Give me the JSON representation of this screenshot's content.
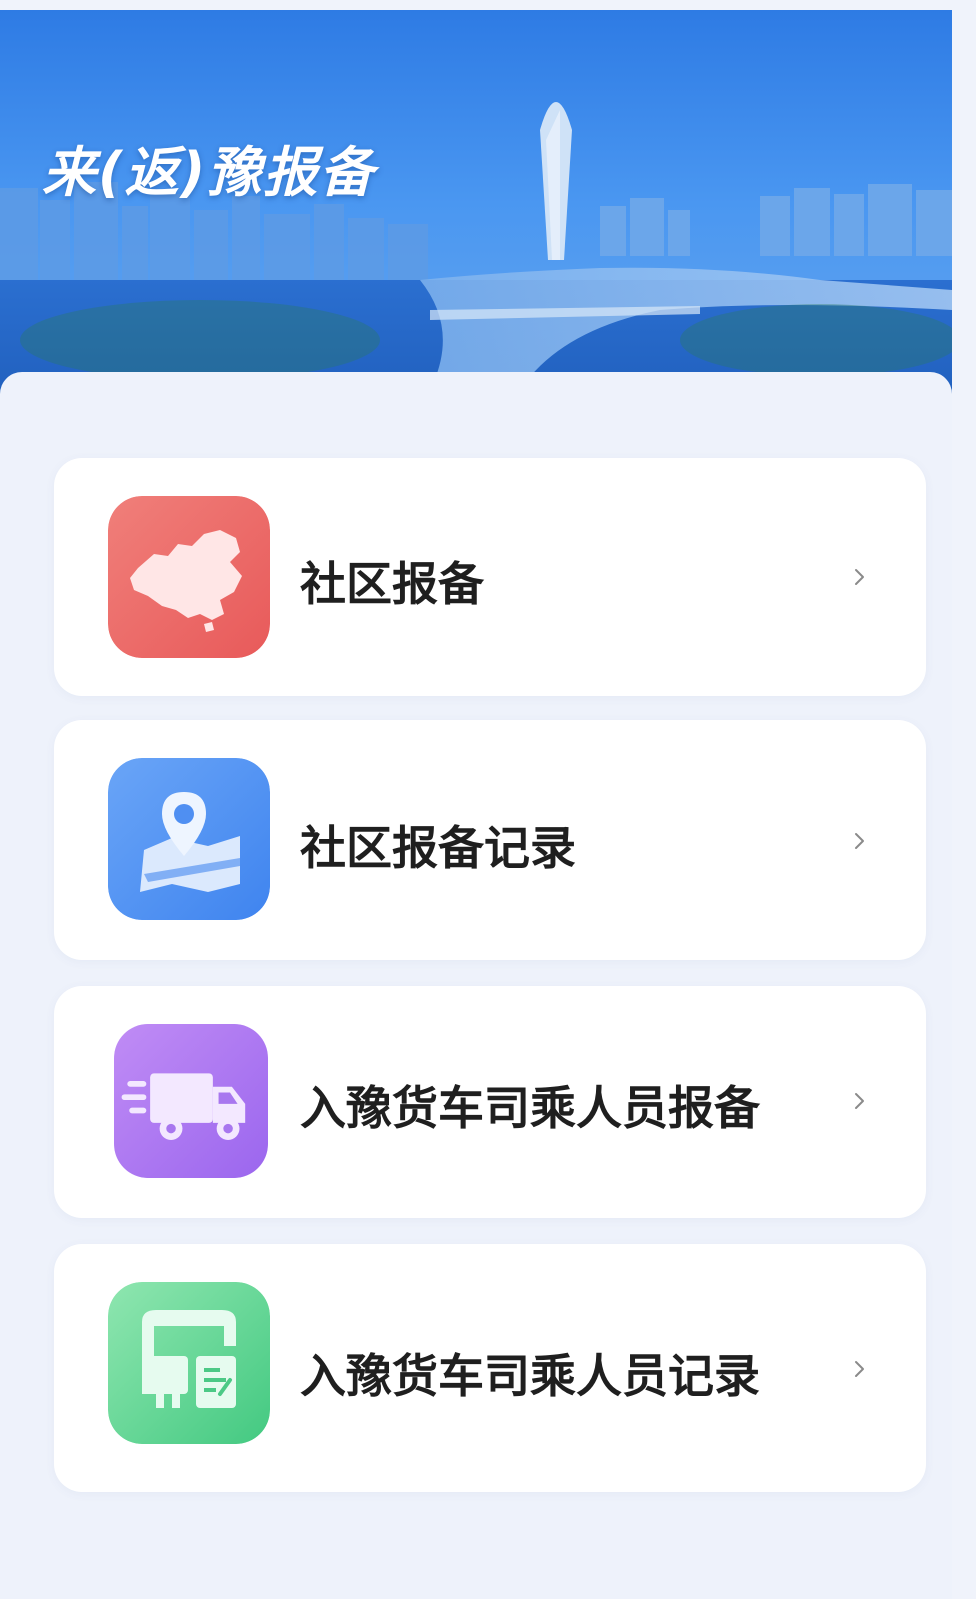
{
  "banner": {
    "title": "来(返)豫报备"
  },
  "menu": {
    "items": [
      {
        "label": "社区报备",
        "icon": "china-map-icon"
      },
      {
        "label": "社区报备记录",
        "icon": "map-pin-icon"
      },
      {
        "label": "入豫货车司乘人员报备",
        "icon": "truck-icon"
      },
      {
        "label": "入豫货车司乘人员记录",
        "icon": "bus-document-icon"
      }
    ]
  },
  "colors": {
    "accent_blue": "#3c8ef0",
    "icon_red": "#ee6b6b",
    "icon_blue": "#4f8ff2",
    "icon_purple": "#b67cf0",
    "icon_green": "#5ed58f"
  }
}
